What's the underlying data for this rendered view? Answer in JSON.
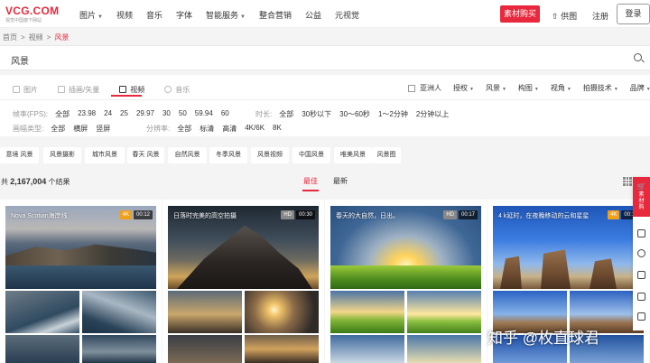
{
  "logo": {
    "main": "VCG.COM",
    "sub": "视觉中国旗下网站"
  },
  "nav": {
    "items": [
      "图片",
      "视频",
      "音乐",
      "字体",
      "智能服务",
      "整合营销",
      "公益",
      "元视觉"
    ],
    "dropdown": [
      true,
      false,
      false,
      false,
      true,
      false,
      false,
      false
    ]
  },
  "header": {
    "buy": "素材购买",
    "cart": "供图",
    "register": "注册",
    "login": "登录"
  },
  "breadcrumb": {
    "home": "首页",
    "video": "视频",
    "current": "风景",
    "sep": ">"
  },
  "search": {
    "value": "风景"
  },
  "tabs": [
    "图片",
    "插画/矢量",
    "视频",
    "音乐"
  ],
  "filters": {
    "asian": "亚洲人",
    "items": [
      "授权",
      "风景",
      "构图",
      "视角",
      "拍摄技术",
      "品牌"
    ]
  },
  "fps": {
    "label": "帧率(FPS):",
    "options": [
      "全部",
      "23.98",
      "24",
      "25",
      "29.97",
      "30",
      "50",
      "59.94",
      "60"
    ]
  },
  "duration": {
    "label": "时长:",
    "options": [
      "全部",
      "30秒以下",
      "30～60秒",
      "1～2分钟",
      "2分钟以上"
    ]
  },
  "orientation": {
    "label": "画幅类型:",
    "options": [
      "全部",
      "横屏",
      "竖屏"
    ]
  },
  "resolution": {
    "label": "分辨率:",
    "options": [
      "全部",
      "标清",
      "高清",
      "4K/6K",
      "8K"
    ]
  },
  "chips": [
    "意境 风景",
    "风景摄影",
    "城市风景",
    "春天 风景",
    "自然风景",
    "冬季风景",
    "风景视频",
    "中国风景",
    "唯美风景",
    "风景图"
  ],
  "results": {
    "prefix": "共",
    "count": "2,167,004",
    "suffix": "个结果"
  },
  "sort": {
    "best": "最佳",
    "latest": "最新"
  },
  "cards": [
    {
      "title": "Nova Scotian海岸线",
      "quality": "4K",
      "duration": "00:12"
    },
    {
      "title": "日落时完美的高空拍摄",
      "quality": "HD",
      "duration": "00:30"
    },
    {
      "title": "春天的大自然，日出。",
      "quality": "HD",
      "duration": "00:17"
    },
    {
      "title": "4 k延时，在夜晚移动的云和星星",
      "quality": "4K",
      "duration": "00:11"
    }
  ],
  "sidebar": {
    "top": "素材购"
  },
  "watermark": "知乎 @枚直球君"
}
